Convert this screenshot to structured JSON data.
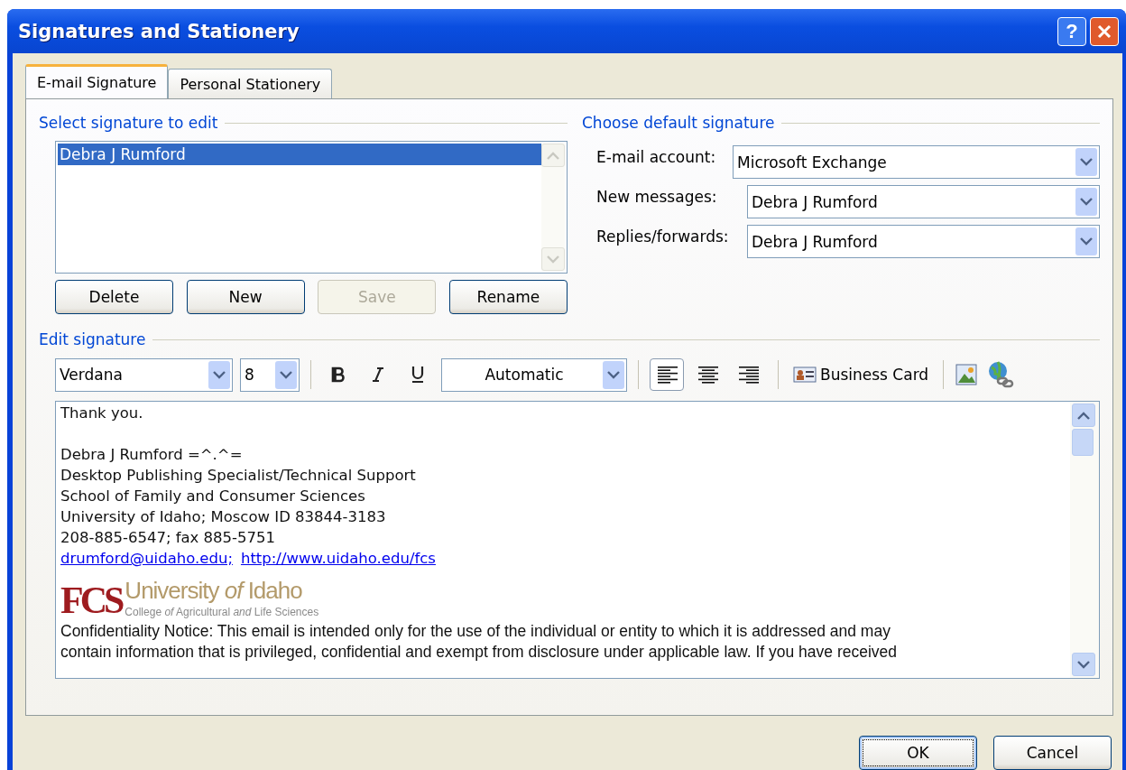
{
  "window": {
    "title": "Signatures and Stationery",
    "help": "?"
  },
  "tabs": [
    {
      "label": "E-mail Signature",
      "selected": true
    },
    {
      "label": "Personal Stationery",
      "selected": false
    }
  ],
  "select_signature": {
    "heading": "Select signature to edit",
    "items": [
      {
        "label": "Debra J Rumford",
        "selected": true
      }
    ],
    "buttons": [
      {
        "label": "Delete",
        "disabled": false
      },
      {
        "label": "New",
        "disabled": false
      },
      {
        "label": "Save",
        "disabled": true
      },
      {
        "label": "Rename",
        "disabled": false
      }
    ]
  },
  "default_signature": {
    "heading": "Choose default signature",
    "fields": [
      {
        "label": "E-mail account:",
        "value": "Microsoft Exchange"
      },
      {
        "label": "New messages:",
        "value": "Debra J Rumford"
      },
      {
        "label": "Replies/forwards:",
        "value": "Debra J Rumford"
      }
    ]
  },
  "edit_signature": {
    "heading": "Edit signature",
    "font": "Verdana",
    "size": "8",
    "color_choice": "Automatic",
    "alignment": [
      {
        "kind": "left",
        "selected": true
      },
      {
        "kind": "center",
        "selected": false
      },
      {
        "kind": "right",
        "selected": false
      }
    ],
    "business_card": "Business Card",
    "body": [
      {
        "kind": "line",
        "text": "Thank you."
      },
      {
        "kind": "blank"
      },
      {
        "kind": "line",
        "text": "Debra J Rumford =^.^="
      },
      {
        "kind": "line",
        "text": "Desktop Publishing Specialist/Technical Support"
      },
      {
        "kind": "line",
        "text": "School of Family and Consumer Sciences"
      },
      {
        "kind": "line",
        "text": "University of Idaho; Moscow ID 83844-3183"
      },
      {
        "kind": "line",
        "text": "208-885-6547; fax 885-5751"
      },
      {
        "kind": "links",
        "links": [
          "drumford@uidaho.edu;",
          "http://www.uidaho.edu/fcs"
        ]
      },
      {
        "kind": "blank"
      },
      {
        "kind": "logo",
        "mark": "FCS",
        "name": "University *of* Idaho",
        "subtitle": "College *of* Agricultural *and* Life Sciences"
      },
      {
        "kind": "notice",
        "lines": [
          "Confidentiality Notice: This email is intended only for the use of the individual or entity to which it is addressed and may",
          "contain information that is privileged, confidential and exempt from disclosure under applicable law. If you have received"
        ]
      }
    ]
  },
  "footer_buttons": [
    {
      "label": "OK",
      "focused": true
    },
    {
      "label": "Cancel",
      "focused": false
    }
  ]
}
